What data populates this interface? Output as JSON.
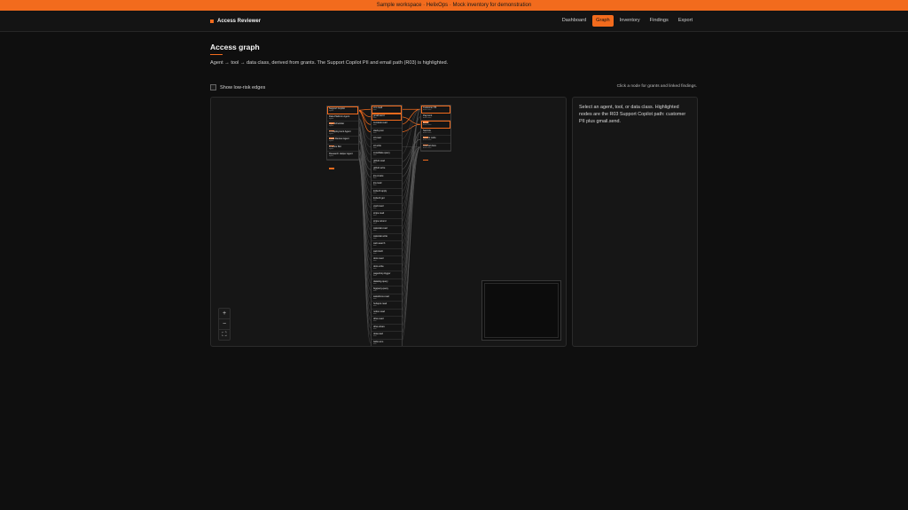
{
  "banner": "Sample workspace · HelixOps · Mock inventory for demonstration",
  "brand": "Access Reviewer",
  "nav": [
    {
      "label": "Dashboard",
      "active": false
    },
    {
      "label": "Graph",
      "active": true
    },
    {
      "label": "Inventory",
      "active": false
    },
    {
      "label": "Findings",
      "active": false
    },
    {
      "label": "Export",
      "active": false
    }
  ],
  "page": {
    "title": "Access graph",
    "description": "Agent → tool → data class, derived from grants. The Support Copilot PII and email path (R03) is highlighted.",
    "toggle_label": "Show low-risk edges",
    "hint": "Click a node for grants and linked findings."
  },
  "panel": {
    "text": "Select an agent, tool, or data class. Highlighted nodes are the R03 Support Copilot path: customer PII plus gmail.send."
  },
  "zoom": {
    "in": "+",
    "out": "−",
    "fit": "⛶"
  },
  "graph": {
    "agents": [
      {
        "label": "Support Copilot",
        "sub": "agent",
        "highlight": true,
        "badge": true
      },
      {
        "label": "Data Platform Agent",
        "sub": "agent",
        "highlight": false,
        "badge": true
      },
      {
        "label": "Ops Scheduler",
        "sub": "agent",
        "highlight": false,
        "badge": true
      },
      {
        "label": "CI Deployment Agent",
        "sub": "agent",
        "highlight": false,
        "badge": true
      },
      {
        "label": "Code Review Agent",
        "sub": "agent",
        "highlight": false,
        "badge": false
      },
      {
        "label": "Finance Bot",
        "sub": "agent",
        "highlight": false,
        "badge": false
      },
      {
        "label": "Research Helper Agent",
        "sub": "agent",
        "highlight": false,
        "badge": true
      }
    ],
    "tools": [
      {
        "label": "crm.read",
        "sub": "tool",
        "highlight": true
      },
      {
        "label": "gmail.send",
        "sub": "tool",
        "highlight": true
      },
      {
        "label": "zendesk.read",
        "sub": "tool",
        "highlight": false
      },
      {
        "label": "slack.post",
        "sub": "tool",
        "highlight": false
      },
      {
        "label": "s3.read",
        "sub": "tool",
        "highlight": false
      },
      {
        "label": "s3.write",
        "sub": "tool",
        "highlight": false
      },
      {
        "label": "snowflake.query",
        "sub": "tool",
        "highlight": false
      },
      {
        "label": "github.read",
        "sub": "tool",
        "highlight": false
      },
      {
        "label": "github.write",
        "sub": "tool",
        "highlight": false
      },
      {
        "label": "jira.create",
        "sub": "tool",
        "highlight": false
      },
      {
        "label": "jira.read",
        "sub": "tool",
        "highlight": false
      },
      {
        "label": "kubectl.apply",
        "sub": "tool",
        "highlight": false
      },
      {
        "label": "kubectl.get",
        "sub": "tool",
        "highlight": false
      },
      {
        "label": "vault.read",
        "sub": "tool",
        "highlight": false
      },
      {
        "label": "stripe.read",
        "sub": "tool",
        "highlight": false
      },
      {
        "label": "stripe.refund",
        "sub": "tool",
        "highlight": false
      },
      {
        "label": "calendar.read",
        "sub": "tool",
        "highlight": false
      },
      {
        "label": "calendar.write",
        "sub": "tool",
        "highlight": false
      },
      {
        "label": "web.search",
        "sub": "tool",
        "highlight": false
      },
      {
        "label": "web.fetch",
        "sub": "tool",
        "highlight": false
      },
      {
        "label": "docs.read",
        "sub": "tool",
        "highlight": false
      },
      {
        "label": "docs.write",
        "sub": "tool",
        "highlight": false
      },
      {
        "label": "pagerduty.trigger",
        "sub": "tool",
        "highlight": false
      },
      {
        "label": "datadog.query",
        "sub": "tool",
        "highlight": false
      },
      {
        "label": "bigquery.query",
        "sub": "tool",
        "highlight": false
      },
      {
        "label": "salesforce.read",
        "sub": "tool",
        "highlight": false
      },
      {
        "label": "hubspot.read",
        "sub": "tool",
        "highlight": false
      },
      {
        "label": "notion.read",
        "sub": "tool",
        "highlight": false
      },
      {
        "label": "drive.read",
        "sub": "tool",
        "highlight": false
      },
      {
        "label": "drive.share",
        "sub": "tool",
        "highlight": false
      },
      {
        "label": "okta.read",
        "sub": "tool",
        "highlight": false
      },
      {
        "label": "twilio.sms",
        "sub": "tool",
        "highlight": false
      }
    ],
    "data": [
      {
        "label": "Customer PII",
        "sub": "data class",
        "highlight": true,
        "badge": true
      },
      {
        "label": "Payment",
        "sub": "data class",
        "highlight": false,
        "badge": false
      },
      {
        "label": "Email",
        "sub": "data class",
        "highlight": true,
        "badge": true
      },
      {
        "label": "Secrets",
        "sub": "data class",
        "highlight": false,
        "badge": true
      },
      {
        "label": "Source code",
        "sub": "data class",
        "highlight": false,
        "badge": false
      },
      {
        "label": "Internal docs",
        "sub": "data class",
        "highlight": false,
        "badge": true
      }
    ],
    "edges": [
      [
        0,
        0,
        0,
        true
      ],
      [
        0,
        1,
        2,
        true
      ],
      [
        0,
        2,
        0,
        true
      ],
      [
        0,
        3,
        2,
        true
      ],
      [
        1,
        4,
        0,
        false
      ],
      [
        1,
        5,
        5,
        false
      ],
      [
        1,
        6,
        0,
        false
      ],
      [
        1,
        7,
        4,
        false
      ],
      [
        2,
        9,
        5,
        false
      ],
      [
        2,
        10,
        5,
        false
      ],
      [
        2,
        16,
        5,
        false
      ],
      [
        2,
        17,
        5,
        false
      ],
      [
        3,
        11,
        3,
        false
      ],
      [
        3,
        12,
        3,
        false
      ],
      [
        3,
        13,
        3,
        false
      ],
      [
        3,
        8,
        4,
        false
      ],
      [
        4,
        7,
        4,
        false
      ],
      [
        4,
        8,
        4,
        false
      ],
      [
        4,
        9,
        5,
        false
      ],
      [
        5,
        14,
        1,
        false
      ],
      [
        5,
        15,
        1,
        false
      ],
      [
        5,
        24,
        0,
        false
      ],
      [
        6,
        18,
        5,
        false
      ],
      [
        6,
        19,
        5,
        false
      ],
      [
        6,
        20,
        5,
        false
      ],
      [
        6,
        21,
        5,
        false
      ],
      [
        6,
        27,
        5,
        false
      ],
      [
        1,
        22,
        5,
        false
      ],
      [
        2,
        23,
        3,
        false
      ],
      [
        6,
        25,
        0,
        false
      ],
      [
        6,
        26,
        0,
        false
      ],
      [
        3,
        30,
        3,
        false
      ],
      [
        5,
        28,
        5,
        false
      ],
      [
        5,
        29,
        5,
        false
      ],
      [
        0,
        31,
        0,
        false
      ]
    ]
  }
}
